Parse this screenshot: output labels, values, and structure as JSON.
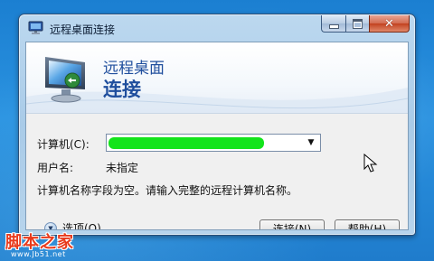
{
  "window": {
    "title": "远程桌面连接",
    "caption_buttons": [
      "minimize",
      "maximize",
      "close"
    ]
  },
  "banner": {
    "line1": "远程桌面",
    "line2": "连接",
    "icon": "remote-desktop-monitor-icon"
  },
  "form": {
    "computer_label": "计算机(C):",
    "computer_value": "",
    "computer_value_redacted": true,
    "username_label": "用户名:",
    "username_value": "未指定",
    "message": "计算机名称字段为空。请输入完整的远程计算机名称。"
  },
  "footer": {
    "options_label": "选项(O)",
    "connect_label": "连接(N)",
    "help_label": "帮助(H)"
  },
  "watermark": {
    "main": "脚本之家",
    "sub": "www.Jb51.net"
  },
  "colors": {
    "banner_text": "#1f4e9d",
    "redaction": "#13e41b",
    "desktop": "#2a92e0"
  }
}
